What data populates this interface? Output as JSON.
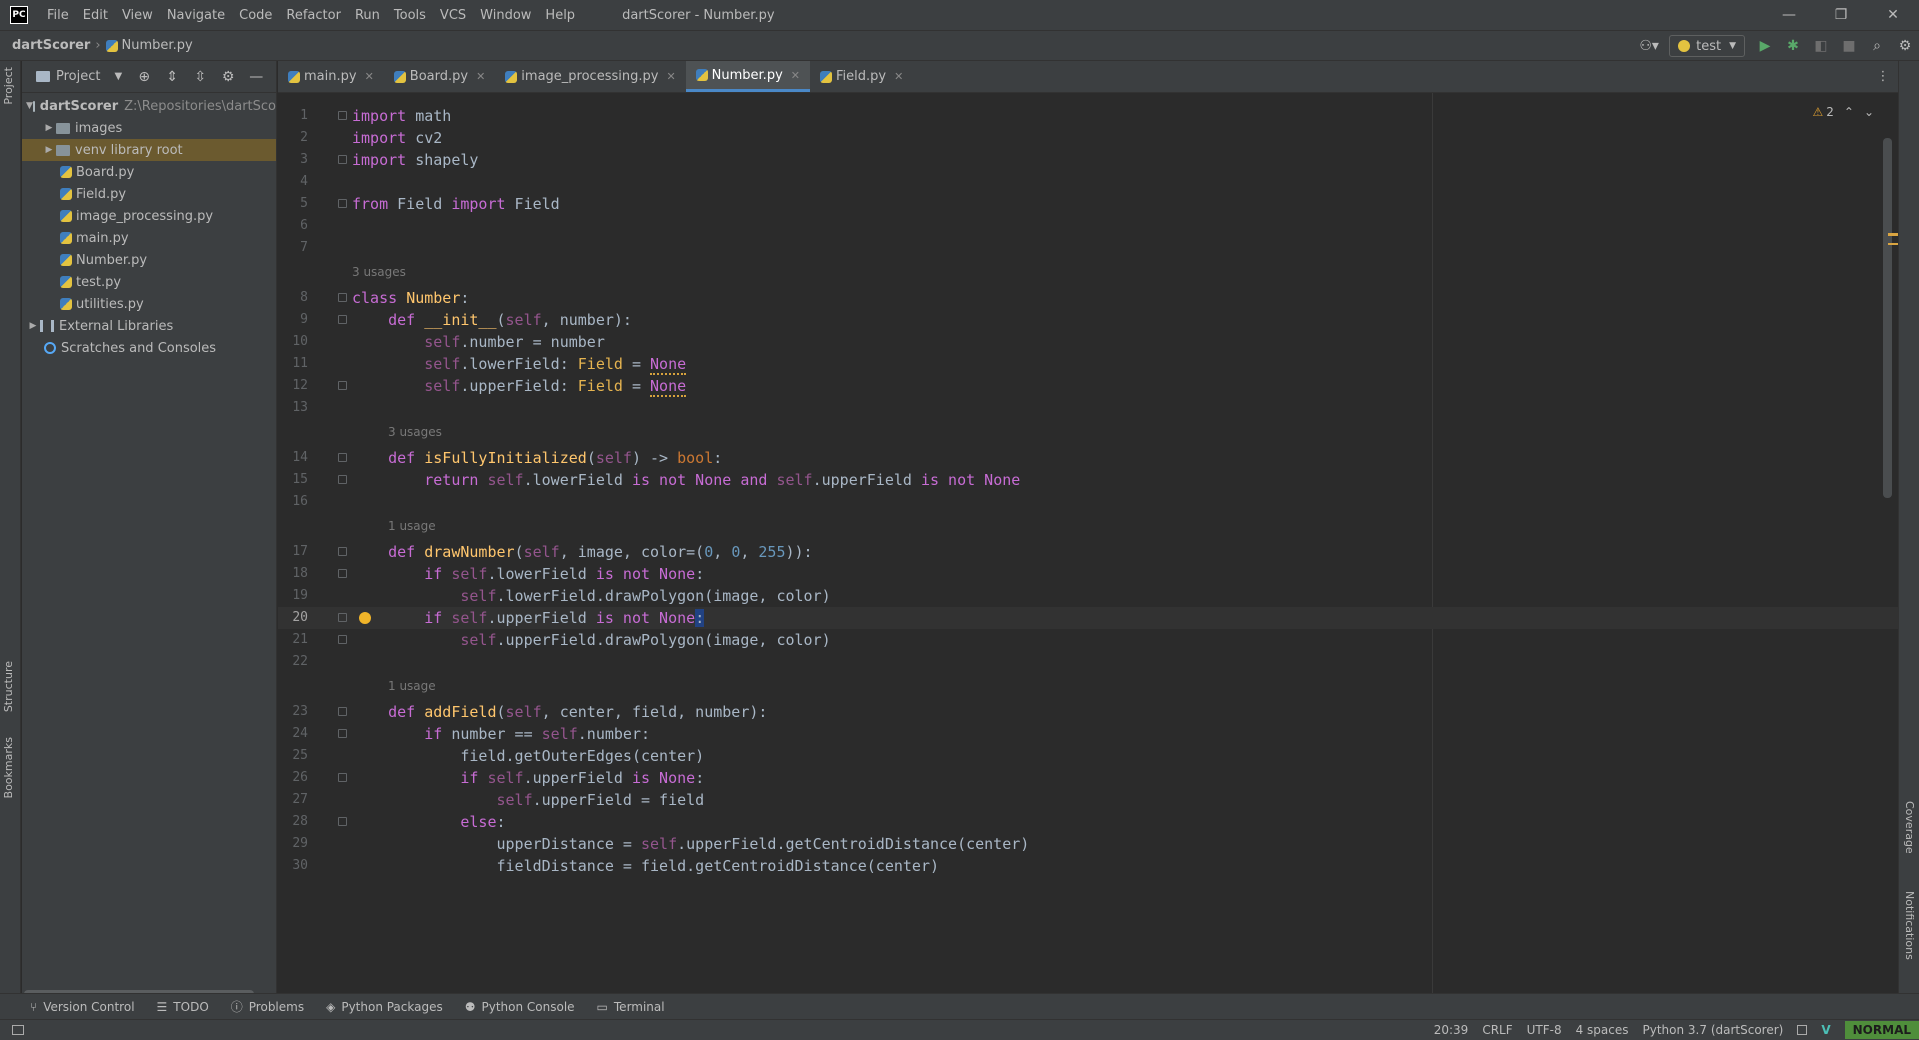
{
  "titlebar": {
    "logo": "PC",
    "menu": [
      "File",
      "Edit",
      "View",
      "Navigate",
      "Code",
      "Refactor",
      "Run",
      "Tools",
      "VCS",
      "Window",
      "Help"
    ],
    "title": "dartScorer - Number.py",
    "controls": {
      "minimize": "—",
      "restore": "❐",
      "close": "✕"
    }
  },
  "navbar": {
    "project": "dartScorer",
    "file": "Number.py",
    "run_config": "test"
  },
  "left_strip": {
    "project": "Project",
    "structure": "Structure",
    "bookmarks": "Bookmarks"
  },
  "right_strip": {
    "coverage": "Coverage",
    "notifications": "Notifications"
  },
  "project_panel": {
    "title": "Project",
    "tree": [
      {
        "label": "dartScorer",
        "muted": "Z:\\Repositories\\dartSco",
        "type": "root"
      },
      {
        "label": "images",
        "type": "folder"
      },
      {
        "label": "venv",
        "muted": "library root",
        "type": "folder",
        "selected": true
      },
      {
        "label": "Board.py",
        "type": "py"
      },
      {
        "label": "Field.py",
        "type": "py"
      },
      {
        "label": "image_processing.py",
        "type": "py"
      },
      {
        "label": "main.py",
        "type": "py"
      },
      {
        "label": "Number.py",
        "type": "py"
      },
      {
        "label": "test.py",
        "type": "py"
      },
      {
        "label": "utilities.py",
        "type": "py"
      },
      {
        "label": "External Libraries",
        "type": "lib"
      },
      {
        "label": "Scratches and Consoles",
        "type": "scratch"
      }
    ]
  },
  "tabs": [
    {
      "label": "main.py",
      "active": false
    },
    {
      "label": "Board.py",
      "active": false
    },
    {
      "label": "image_processing.py",
      "active": false
    },
    {
      "label": "Number.py",
      "active": true
    },
    {
      "label": "Field.py",
      "active": false
    }
  ],
  "inspections": {
    "warnings": "2"
  },
  "code": {
    "lines": [
      "1",
      "2",
      "3",
      "4",
      "5",
      "6",
      "7",
      "8",
      "9",
      "10",
      "11",
      "12",
      "13",
      "14",
      "15",
      "16",
      "17",
      "18",
      "19",
      "20",
      "21",
      "22",
      "23",
      "24",
      "25",
      "26",
      "27",
      "28",
      "29",
      "30"
    ],
    "hints": {
      "class_usages": "3 usages",
      "isfully_usages": "3 usages",
      "draw_usages": "1 usage",
      "add_usages": "1 usage"
    },
    "current_line": "20"
  },
  "tool_windows": [
    "Version Control",
    "TODO",
    "Problems",
    "Python Packages",
    "Python Console",
    "Terminal"
  ],
  "status": {
    "position": "20:39",
    "line_sep": "CRLF",
    "encoding": "UTF-8",
    "indent": "4 spaces",
    "interpreter": "Python 3.7 (dartScorer)",
    "vim_mode": "NORMAL"
  },
  "colors": {
    "accent": "#4a88c7",
    "keyword": "#cc7832",
    "function": "#ffc66d",
    "vim_mode": "#4f8e3b"
  }
}
